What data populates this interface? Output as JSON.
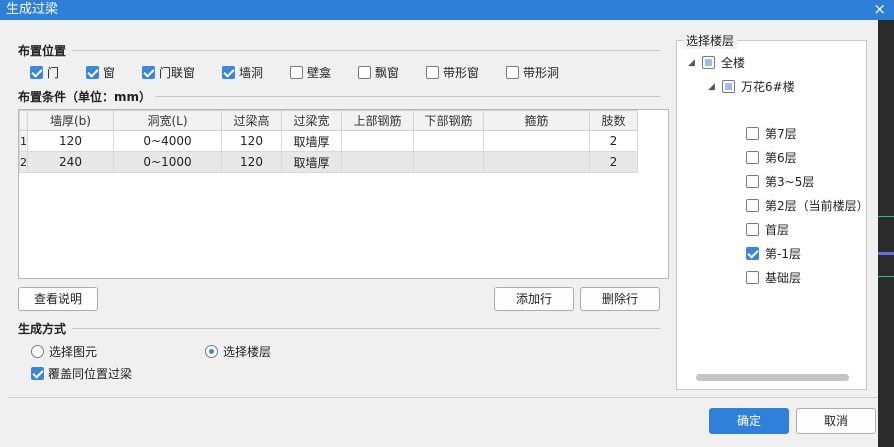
{
  "window": {
    "title": "生成过梁",
    "close_glyph": "×"
  },
  "placement": {
    "heading": "布置位置",
    "options": [
      {
        "label": "门",
        "checked": true
      },
      {
        "label": "窗",
        "checked": true
      },
      {
        "label": "门联窗",
        "checked": true
      },
      {
        "label": "墙洞",
        "checked": true
      },
      {
        "label": "壁龛",
        "checked": false
      },
      {
        "label": "飘窗",
        "checked": false
      },
      {
        "label": "带形窗",
        "checked": false
      },
      {
        "label": "带形洞",
        "checked": false
      }
    ]
  },
  "conditions": {
    "heading": "布置条件（单位：mm）",
    "columns": [
      "墙厚(b)",
      "洞宽(L)",
      "过梁高",
      "过梁宽",
      "上部钢筋",
      "下部钢筋",
      "箍筋",
      "肢数"
    ],
    "rows": [
      {
        "index": "1",
        "cells": [
          "120",
          "0~4000",
          "120",
          "取墙厚",
          "",
          "",
          "",
          "2"
        ]
      },
      {
        "index": "2",
        "cells": [
          "240",
          "0~1000",
          "120",
          "取墙厚",
          "",
          "",
          "",
          "2"
        ]
      }
    ]
  },
  "buttons": {
    "view_help": "查看说明",
    "add_row": "添加行",
    "delete_row": "删除行",
    "ok": "确定",
    "cancel": "取消"
  },
  "generate": {
    "heading": "生成方式",
    "radio_elements": "选择图元",
    "radio_floors": "选择楼层",
    "selected": "floors",
    "overwrite_label": "覆盖同位置过梁",
    "overwrite_checked": true
  },
  "floors": {
    "title": "选择楼层",
    "root": "全楼",
    "building": "万花6#楼",
    "items": [
      {
        "label": "第7层",
        "checked": false
      },
      {
        "label": "第6层",
        "checked": false
      },
      {
        "label": "第3~5层",
        "checked": false
      },
      {
        "label": "第2层（当前楼层）",
        "checked": false
      },
      {
        "label": "首层",
        "checked": false
      },
      {
        "label": "第-1层",
        "checked": true
      },
      {
        "label": "基础层",
        "checked": false
      }
    ]
  },
  "colors": {
    "accent": "#2d7fd8"
  }
}
